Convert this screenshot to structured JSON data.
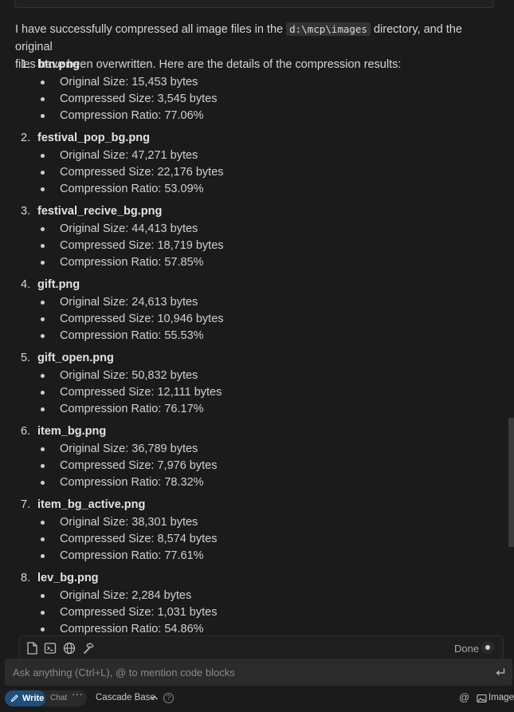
{
  "message": {
    "intro_before": "I have successfully compressed all image files in the ",
    "intro_code": "d:\\mcp\\images",
    "intro_after_line1": " directory, and the original",
    "intro_line2": "files have been overwritten. Here are the details of the compression results:",
    "files": [
      {
        "num": "1.",
        "name": "btn.png",
        "original": "Original Size: 15,453 bytes",
        "compressed": "Compressed Size: 3,545 bytes",
        "ratio": "Compression Ratio: 77.06%"
      },
      {
        "num": "2.",
        "name": "festival_pop_bg.png",
        "original": "Original Size: 47,271 bytes",
        "compressed": "Compressed Size: 22,176 bytes",
        "ratio": "Compression Ratio: 53.09%"
      },
      {
        "num": "3.",
        "name": "festival_recive_bg.png",
        "original": "Original Size: 44,413 bytes",
        "compressed": "Compressed Size: 18,719 bytes",
        "ratio": "Compression Ratio: 57.85%"
      },
      {
        "num": "4.",
        "name": "gift.png",
        "original": "Original Size: 24,613 bytes",
        "compressed": "Compressed Size: 10,946 bytes",
        "ratio": "Compression Ratio: 55.53%"
      },
      {
        "num": "5.",
        "name": "gift_open.png",
        "original": "Original Size: 50,832 bytes",
        "compressed": "Compressed Size: 12,111 bytes",
        "ratio": "Compression Ratio: 76.17%"
      },
      {
        "num": "6.",
        "name": "item_bg.png",
        "original": "Original Size: 36,789 bytes",
        "compressed": "Compressed Size: 7,976 bytes",
        "ratio": "Compression Ratio: 78.32%"
      },
      {
        "num": "7.",
        "name": "item_bg_active.png",
        "original": "Original Size: 38,301 bytes",
        "compressed": "Compressed Size: 8,574 bytes",
        "ratio": "Compression Ratio: 77.61%"
      },
      {
        "num": "8.",
        "name": "lev_bg.png",
        "original": "Original Size: 2,284 bytes",
        "compressed": "Compressed Size: 1,031 bytes",
        "ratio": "Compression Ratio: 54.86%"
      }
    ]
  },
  "toolbar": {
    "icons": [
      "file-icon",
      "terminal-icon",
      "globe-icon",
      "hammer-icon"
    ],
    "done_label": "Done"
  },
  "input": {
    "placeholder": "Ask anything (Ctrl+L), @ to mention code blocks",
    "value": ""
  },
  "bottom_bar": {
    "write_label": "Write",
    "chat_label": "Chat",
    "more_label": "···",
    "model_label": "Cascade Base",
    "help_label": "?",
    "mention_label": "@",
    "image_label": "Image"
  },
  "colors": {
    "background": "#1b1b1b",
    "text": "#d4d4d4",
    "write_accent": "#1e4f7a",
    "input_bg": "#2b2b2b"
  }
}
